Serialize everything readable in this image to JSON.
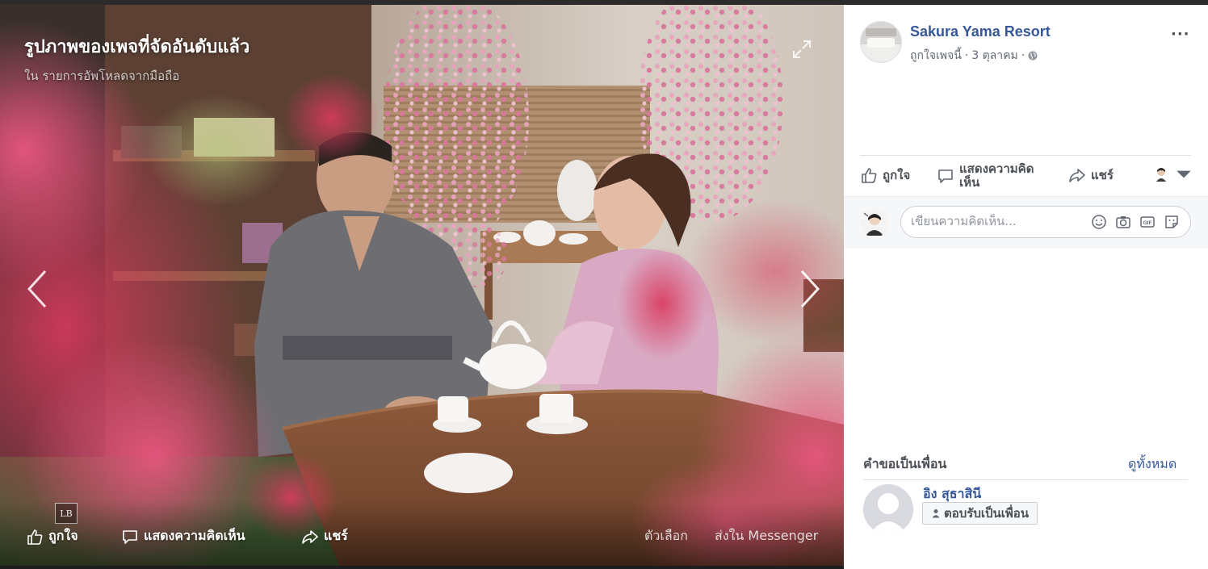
{
  "viewer": {
    "title": "รูปภาพของเพจที่จัดอันดับแล้ว",
    "subtitle": "ใน รายการอัพโหลดจากมือถือ",
    "watermark": "LB",
    "actions": {
      "like_label": "ถูกใจ",
      "comment_label": "แสดงความคิดเห็น",
      "share_label": "แชร์",
      "options_label": "ตัวเลือก",
      "messenger_label": "ส่งใน Messenger"
    }
  },
  "post": {
    "page_name": "Sakura Yama Resort",
    "meta_like_page": "ถูกใจเพจนี้",
    "meta_separator": "·",
    "date": "3 ตุลาคม",
    "meta_separator2": "·",
    "more_label": "···",
    "actions": {
      "like_label": "ถูกใจ",
      "comment_label": "แสดงความคิดเห็น",
      "share_label": "แชร์"
    }
  },
  "comment": {
    "placeholder": "เขียนความคิดเห็น..."
  },
  "friend_requests": {
    "title": "คำขอเป็นเพื่อน",
    "see_all": "ดูทั้งหมด",
    "items": [
      {
        "name": "อิง สุธาสินี",
        "accept_label": "ตอบรับเป็นเพื่อน"
      }
    ]
  },
  "colors": {
    "link_blue": "#365899",
    "panel_bg": "#ffffff",
    "viewer_bg": "#1d1d1d",
    "blossom_pink": "#e8567f"
  }
}
